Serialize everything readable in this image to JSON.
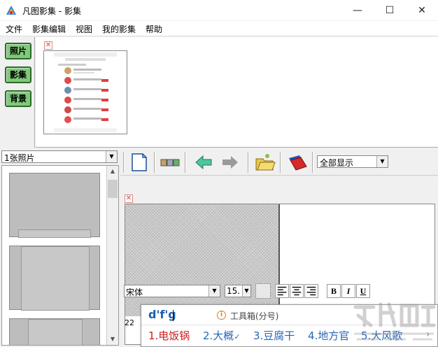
{
  "window": {
    "title": "凡图影集 - 影集",
    "minimize_glyph": "—",
    "maximize_glyph": "☐",
    "close_glyph": "✕"
  },
  "menu": [
    "文件",
    "影集编辑",
    "视图",
    "我的影集",
    "帮助"
  ],
  "side_tabs": [
    "照片",
    "影集",
    "背景"
  ],
  "thumbnail_strip": {
    "close_glyph": "✕",
    "photo_icon": "phone-screenshot-thumbnail"
  },
  "left_panel": {
    "selector_value": "1张照片",
    "scroll_up_glyph": "▲",
    "scroll_down_glyph": "▼"
  },
  "toolbar": {
    "buttons": [
      "new-page-icon",
      "layout-icon",
      "back-arrow-icon",
      "forward-arrow-icon",
      "open-folder-icon",
      "album-book-icon"
    ],
    "view_select_value": "全部显示"
  },
  "editor": {
    "close_glyph": "✕",
    "line_number": "22"
  },
  "format_bar": {
    "font": "宋体",
    "size": "15.",
    "bold_label": "B",
    "italic_label": "I",
    "underline_label": "U"
  },
  "ime": {
    "input": "d'f'g",
    "hint": "工具箱(分号)",
    "info_glyph": "i",
    "candidates": [
      "1.电饭锅",
      "2.大概",
      "3.豆腐干",
      "4.地方官",
      "5.大风歌"
    ],
    "check_glyph": "✓",
    "more_glyph": "›"
  },
  "colors": {
    "tab_green": "#7fc97b",
    "ime_blue": "#2566b8",
    "ime_selected_red": "#d01c1c"
  }
}
